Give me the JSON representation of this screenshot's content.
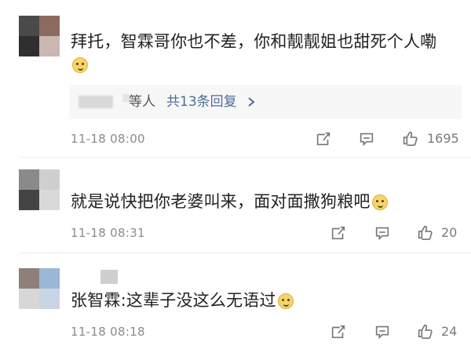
{
  "comments": [
    {
      "text": "拜托，智霖哥你也不差，你和靓靓姐也甜死个人嘞",
      "emoji": "doge-emoji",
      "replies": {
        "label": "等人",
        "link": "共13条回复"
      },
      "time": "11-18 08:00",
      "likes": "1695"
    },
    {
      "text": "就是说快把你老婆叫来，面对面撒狗粮吧",
      "emoji": "doge-emoji",
      "time": "11-18 08:31",
      "likes": "20"
    },
    {
      "text": "张智霖:这辈子没这么无语过",
      "emoji": "doge-emoji",
      "time": "11-18 08:18",
      "likes": "24"
    }
  ],
  "icons": {
    "share": "share-icon",
    "comment": "comment-icon",
    "like": "thumbs-up-icon",
    "more": "chevron-right-icon"
  },
  "colors": {
    "text": "#222222",
    "meta": "#8b8b8b",
    "link": "#4e6c99",
    "reply_bg": "#f7f7f7",
    "emoji": "#f4d56a"
  }
}
